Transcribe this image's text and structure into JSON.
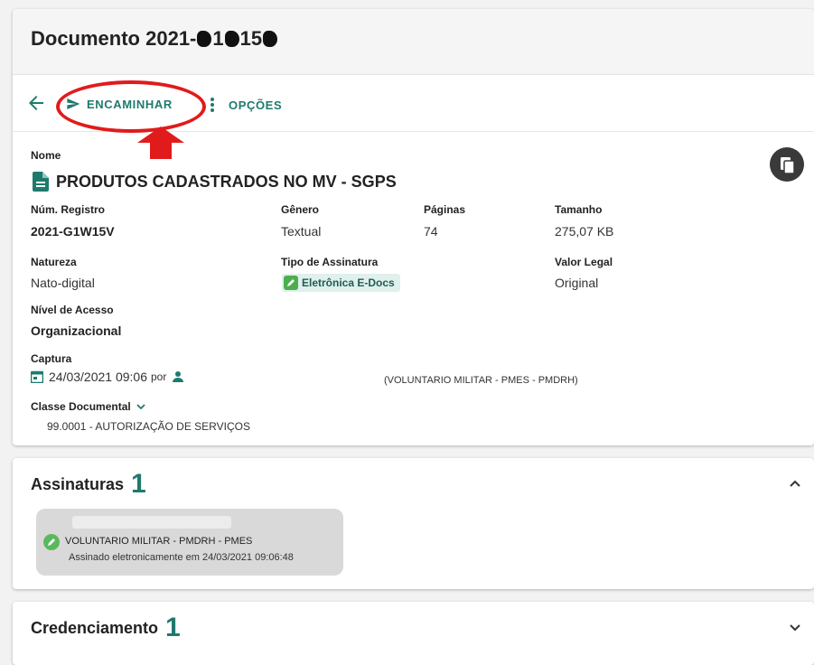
{
  "header": {
    "title": "Documento 2021-",
    "title_tail": "1",
    "title_tail2": "15"
  },
  "toolbar": {
    "forward_label": "ENCAMINHAR",
    "options_label": "OPÇÕES"
  },
  "document": {
    "name_label": "Nome",
    "name": "PRODUTOS CADASTRADOS NO MV - SGPS",
    "fields": {
      "registro_label": "Núm. Registro",
      "registro": "2021-G1W15V",
      "genero_label": "Gênero",
      "genero": "Textual",
      "paginas_label": "Páginas",
      "paginas": "74",
      "tamanho_label": "Tamanho",
      "tamanho": "275,07 KB",
      "natureza_label": "Natureza",
      "natureza": "Nato-digital",
      "assinatura_label": "Tipo de Assinatura",
      "assinatura": "Eletrônica E-Docs",
      "valor_label": "Valor Legal",
      "valor": "Original",
      "acesso_label": "Nível de Acesso",
      "acesso": "Organizacional",
      "captura_label": "Captura",
      "captura_date": "24/03/2021 09:06",
      "captura_por": "por",
      "captura_org": "(VOLUNTARIO MILITAR - PMES - PMDRH)",
      "classe_label": "Classe Documental",
      "classe": "99.0001 - AUTORIZAÇÃO DE SERVIÇOS"
    }
  },
  "assinaturas": {
    "title": "Assinaturas",
    "count": "1",
    "signer": "VOLUNTARIO MILITAR - PMDRH - PMES",
    "signed_text": "Assinado eletronicamente em 24/03/2021 09:06:48"
  },
  "credenciamento": {
    "title": "Credenciamento",
    "count": "1"
  },
  "colors": {
    "accent": "#1f7a6e",
    "annotation": "#e11b1b",
    "badge_bg": "#e0f0ec",
    "sign_icon": "#5cb85c"
  }
}
